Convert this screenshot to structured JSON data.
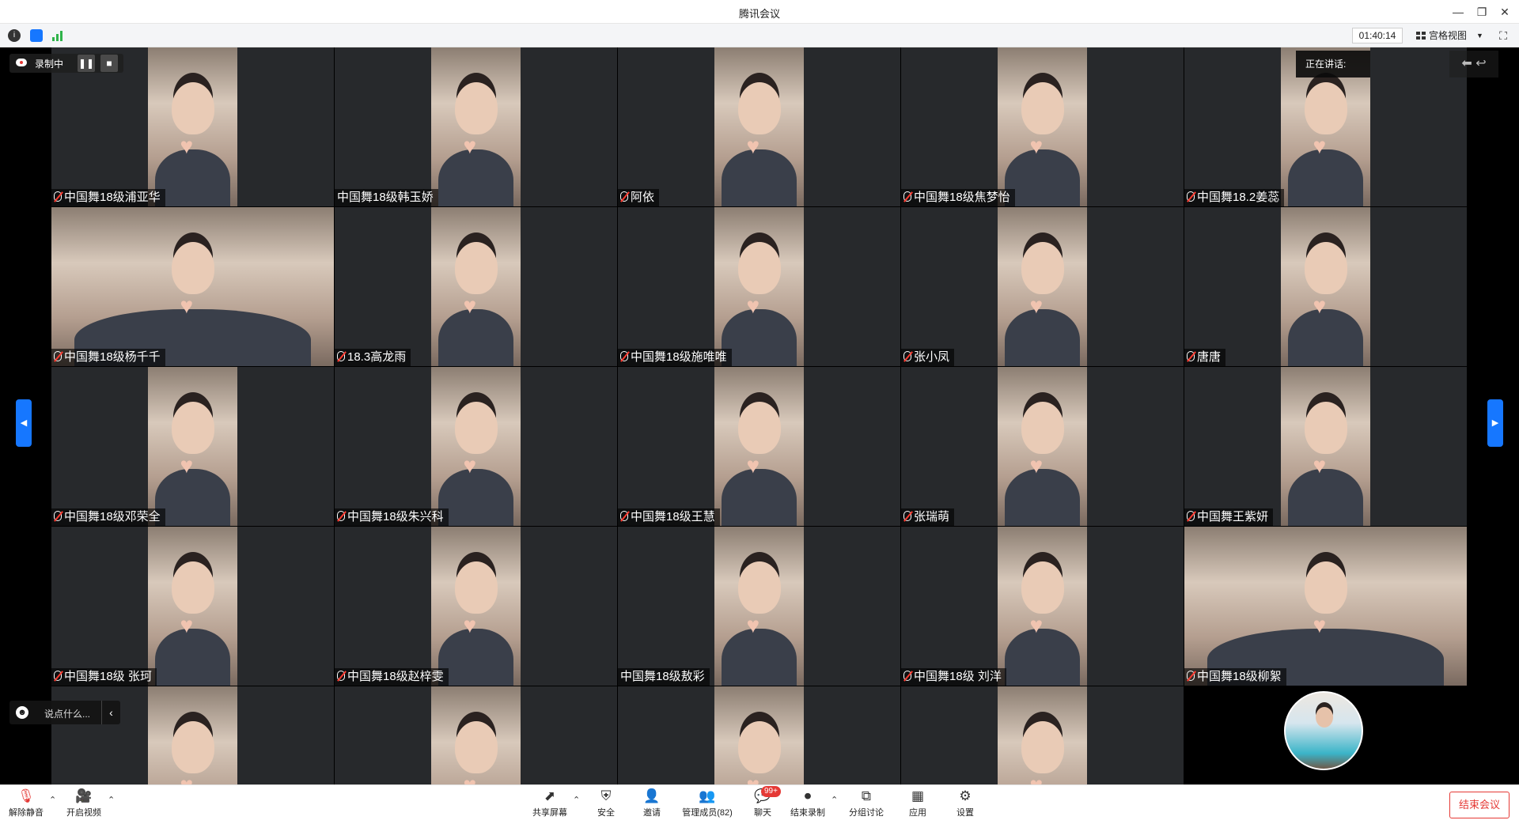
{
  "window": {
    "title": "腾讯会议"
  },
  "infobar": {
    "timer": "01:40:14",
    "view_mode": "宫格视图"
  },
  "recording": {
    "label": "录制中"
  },
  "speaking": {
    "label": "正在讲话:"
  },
  "chat_input": {
    "placeholder": "说点什么..."
  },
  "participants": [
    {
      "name": "中国舞18级浦亚华",
      "muted": true,
      "wide": false
    },
    {
      "name": "中国舞18级韩玉娇",
      "muted": false,
      "wide": false
    },
    {
      "name": "阿依",
      "muted": true,
      "wide": false
    },
    {
      "name": "中国舞18级焦梦怡",
      "muted": true,
      "wide": false
    },
    {
      "name": "中国舞18.2姜蕊",
      "muted": true,
      "wide": false
    },
    {
      "name": "中国舞18级杨千千",
      "muted": true,
      "wide": true
    },
    {
      "name": "18.3高龙雨",
      "muted": true,
      "wide": false
    },
    {
      "name": "中国舞18级施唯唯",
      "muted": true,
      "wide": false
    },
    {
      "name": "张小凤",
      "muted": true,
      "wide": false
    },
    {
      "name": "唐唐",
      "muted": true,
      "wide": false
    },
    {
      "name": "中国舞18级邓荣全",
      "muted": true,
      "wide": false
    },
    {
      "name": "中国舞18级朱兴科",
      "muted": true,
      "wide": false
    },
    {
      "name": "中国舞18级王慧",
      "muted": true,
      "wide": false
    },
    {
      "name": "张瑞萌",
      "muted": true,
      "wide": false
    },
    {
      "name": "中国舞王紫妍",
      "muted": true,
      "wide": false
    },
    {
      "name": "中国舞18级 张珂",
      "muted": true,
      "wide": false
    },
    {
      "name": "中国舞18级赵梓雯",
      "muted": true,
      "wide": false
    },
    {
      "name": "中国舞18级敖彩",
      "muted": false,
      "wide": false
    },
    {
      "name": "中国舞18级  刘洋",
      "muted": true,
      "wide": false
    },
    {
      "name": "中国舞18级柳絮",
      "muted": true,
      "wide": true
    },
    {
      "name": "",
      "muted": false,
      "wide": false
    },
    {
      "name": "",
      "muted": false,
      "wide": false
    },
    {
      "name": "",
      "muted": false,
      "wide": false
    },
    {
      "name": "",
      "muted": false,
      "wide": false
    }
  ],
  "toolbar": {
    "unmute": "解除静音",
    "start_video": "开启视频",
    "share_screen": "共享屏幕",
    "security": "安全",
    "invite": "邀请",
    "manage_members": "管理成员(82)",
    "chat": "聊天",
    "chat_badge": "99+",
    "end_recording": "结束录制",
    "breakout": "分组讨论",
    "apps": "应用",
    "settings": "设置",
    "end_meeting": "结束会议"
  }
}
